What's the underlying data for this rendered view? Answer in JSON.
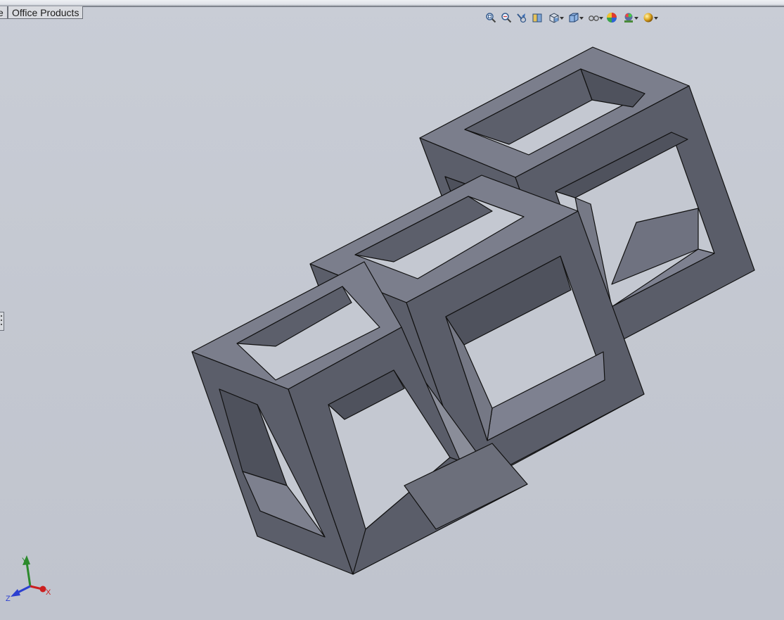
{
  "document_tabs": [
    {
      "label": "e",
      "partial": true
    },
    {
      "label": "Office Products",
      "partial": false
    }
  ],
  "view_toolbar": {
    "tools": [
      {
        "icon": "zoom-to-fit-icon"
      },
      {
        "icon": "zoom-to-area-icon"
      },
      {
        "icon": "previous-view-icon"
      },
      {
        "icon": "section-view-icon"
      },
      {
        "icon": "view-orientation-icon",
        "dropdown": true
      },
      {
        "icon": "display-style-icon",
        "dropdown": true
      },
      {
        "icon": "hide-show-items-icon",
        "dropdown": true
      },
      {
        "icon": "edit-appearance-icon"
      },
      {
        "icon": "apply-scene-icon",
        "dropdown": true
      },
      {
        "icon": "view-settings-icon",
        "dropdown": true
      }
    ]
  },
  "triad": {
    "x_label": "X",
    "y_label": "Y",
    "z_label": "Z"
  },
  "colors": {
    "viewport_background": "#c4c8d1",
    "model_top_face": "#7c7f8d",
    "model_side_face": "#5a5d69",
    "model_dark_face": "#4e515c",
    "model_edge": "#111111",
    "x_axis": "#cc1f1f",
    "y_axis": "#2c8a2c",
    "z_axis": "#2b3fd0"
  }
}
